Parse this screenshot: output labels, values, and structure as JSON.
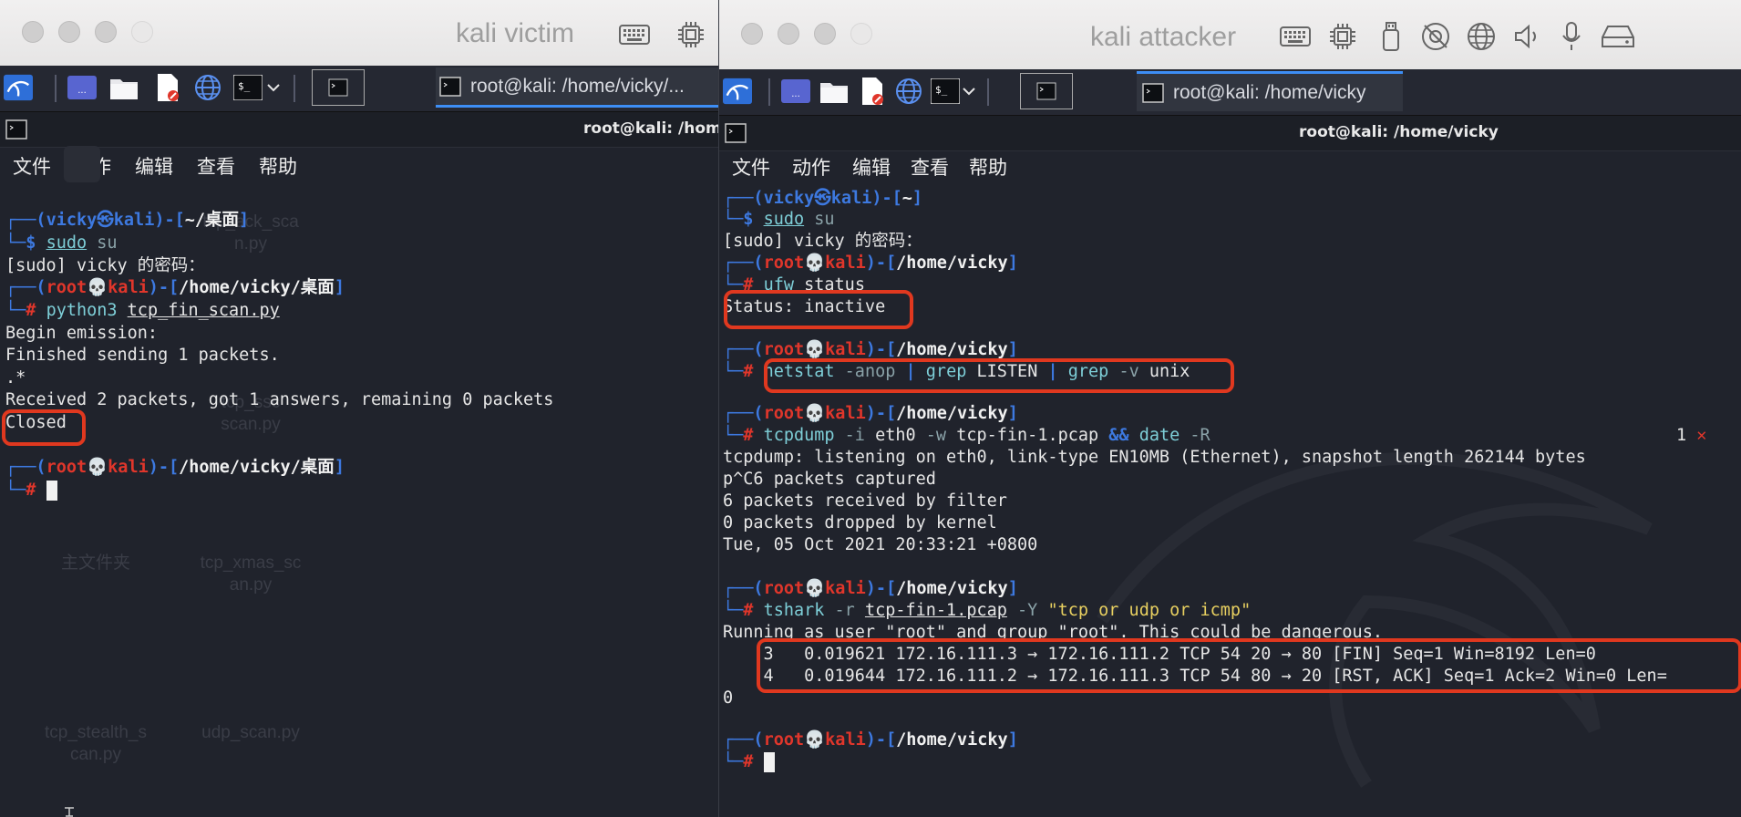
{
  "left_window": {
    "vm_title": "kali victim",
    "taskbar_task": "root@kali: /home/vicky/...",
    "terminal_title": "root@kali: /home/vicky",
    "menu": [
      "文件",
      "动作",
      "编辑",
      "查看",
      "帮助"
    ],
    "desktop_icons": [
      {
        "label": "tcp_ack_sca\nn.py"
      },
      {
        "label": "tcp_ssc\nscan.py"
      },
      {
        "label": "主文件夹"
      },
      {
        "label": "tcp_xmas_sc\nan.py"
      },
      {
        "label": "tcp_stealth_s\ncan.py"
      },
      {
        "label": "udp_scan.py"
      }
    ],
    "terminal": {
      "user": "vicky",
      "host": "kali",
      "cwd1": "~/桌面",
      "cmd1": "sudo",
      "cmd1_arg": "su",
      "sudo_prompt": "[sudo] vicky 的密码：",
      "root_user": "root",
      "cwd2": "/home/vicky/桌面",
      "cmd2": "python3",
      "cmd2_arg": "tcp_fin_scan.py",
      "out1": "Begin emission:",
      "out2": "Finished sending 1 packets.",
      "out3": ".*",
      "out4": "Received 2 packets, got 1 answers, remaining 0 packets",
      "out5": "Closed",
      "cwd3": "/home/vicky/桌面"
    }
  },
  "right_window": {
    "vm_title": "kali attacker",
    "taskbar_task": "root@kali: /home/vicky",
    "terminal_title": "root@kali: /home/vicky",
    "menu": [
      "文件",
      "动作",
      "编辑",
      "查看",
      "帮助"
    ],
    "terminal": {
      "user": "vicky",
      "host": "kali",
      "home": "~",
      "cmd1": "sudo",
      "cmd1_arg": "su",
      "sudo_prompt": "[sudo] vicky 的密码：",
      "root_user": "root",
      "cwd": "/home/vicky",
      "cmd2": "ufw",
      "cmd2_arg": "status",
      "status": "Status: inactive",
      "cmd3_a": "netstat",
      "cmd3_b": "-anop",
      "cmd3_c": "grep",
      "cmd3_d": "LISTEN",
      "cmd3_e": "grep",
      "cmd3_f": "-v",
      "cmd3_g": "unix",
      "cmd4_a": "tcpdump",
      "cmd4_b": "-i",
      "cmd4_c": "eth0",
      "cmd4_d": "-w",
      "cmd4_e": "tcp-fin-1.pcap",
      "cmd4_f": "&&",
      "cmd4_g": "date",
      "cmd4_h": "-R",
      "exit_code": "1",
      "exit_mark": "✕",
      "out1": "tcpdump: listening on eth0, link-type EN10MB (Ethernet), snapshot length 262144 bytes",
      "out2": "p^C6 packets captured",
      "out3": "6 packets received by filter",
      "out4": "0 packets dropped by kernel",
      "out5": "Tue, 05 Oct 2021 20:33:21 +0800",
      "cmd5_a": "tshark",
      "cmd5_b": "-r",
      "cmd5_c": "tcp-fin-1.pcap",
      "cmd5_d": "-Y",
      "cmd5_e": "\"tcp or udp or icmp\"",
      "out6": "Running as user \"root\" and group \"root\". This could be dangerous.",
      "pkt1": "    3   0.019621 172.16.111.3 → 172.16.111.2 TCP 54 20 → 80 [FIN] Seq=1 Win=8192 Len=0",
      "pkt2": "    4   0.019644 172.16.111.2 → 172.16.111.3 TCP 54 80 → 20 [RST, ACK] Seq=1 Ack=2 Win=0 Len=",
      "pkt2_wrap": "0"
    }
  },
  "colors": {
    "highlight": "#e0381f",
    "prompt_blue": "#3d79e0",
    "prompt_red": "#e0362b",
    "cmd": "#7ecfd8",
    "string": "#e8d060"
  },
  "icons": {
    "kali_menu": "kali-dragon-icon",
    "workspace": "workspace-icon",
    "files": "files-icon",
    "text_editor": "text-editor-icon",
    "browser": "globe-icon",
    "terminal": "terminal-icon",
    "vm_toolbar": [
      "keyboard-icon",
      "cpu-icon",
      "usb-icon",
      "camera-off-icon",
      "network-icon",
      "speaker-icon",
      "microphone-icon",
      "drive-icon"
    ]
  }
}
